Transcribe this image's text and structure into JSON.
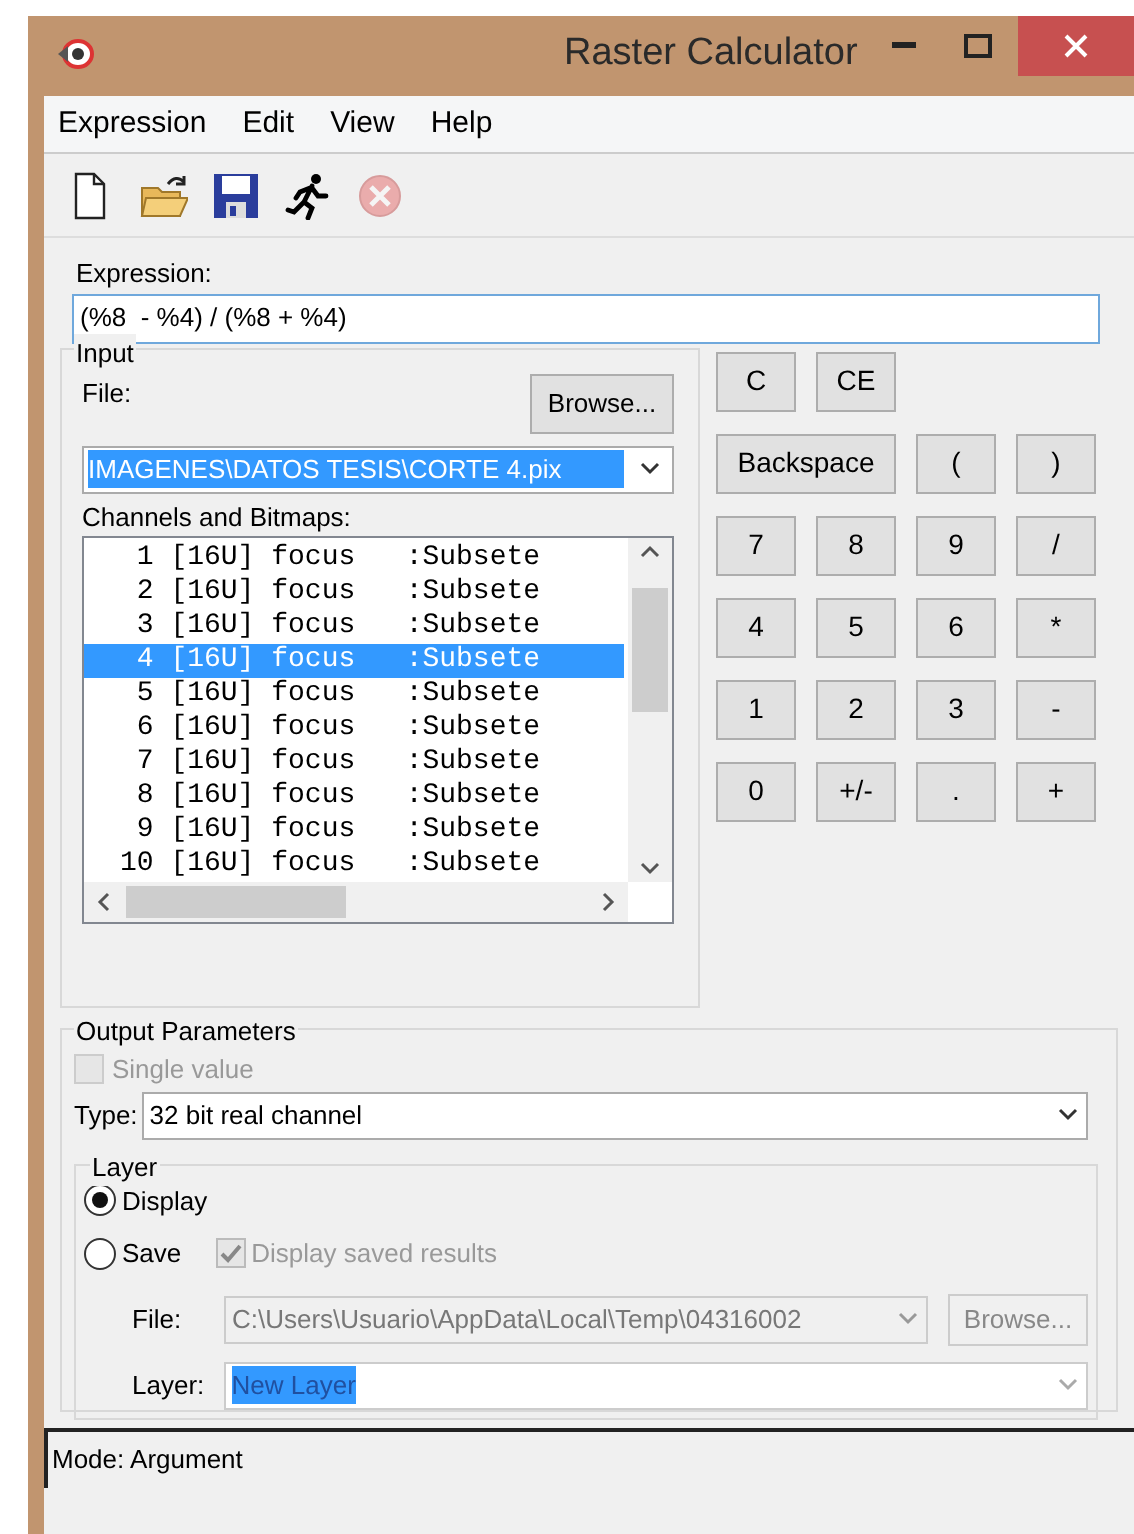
{
  "window": {
    "title": "Raster Calculator"
  },
  "menu": [
    "Expression",
    "Edit",
    "View",
    "Help"
  ],
  "toolbar": [
    {
      "kind": "new",
      "disabled": false
    },
    {
      "kind": "open",
      "disabled": false
    },
    {
      "kind": "save",
      "disabled": false
    },
    {
      "kind": "run",
      "disabled": false
    },
    {
      "kind": "stop",
      "disabled": true
    }
  ],
  "expression": {
    "label": "Expression:",
    "value": "(%8  - %4) / (%8 + %4)"
  },
  "input": {
    "title": "Input",
    "file_label": "File:",
    "browse": "Browse...",
    "file_value": "IMAGENES\\DATOS TESIS\\CORTE 4.pix",
    "file_highlighted": true,
    "channels_label": "Channels and Bitmaps:",
    "channels": [
      {
        "text": " 1 [16U] focus   :Subsete",
        "selected": false
      },
      {
        "text": " 2 [16U] focus   :Subsete",
        "selected": false
      },
      {
        "text": " 3 [16U] focus   :Subsete",
        "selected": false
      },
      {
        "text": " 4 [16U] focus   :Subsete",
        "selected": true
      },
      {
        "text": " 5 [16U] focus   :Subsete",
        "selected": false
      },
      {
        "text": " 6 [16U] focus   :Subsete",
        "selected": false
      },
      {
        "text": " 7 [16U] focus   :Subsete",
        "selected": false
      },
      {
        "text": " 8 [16U] focus   :Subsete",
        "selected": false
      },
      {
        "text": " 9 [16U] focus   :Subsete",
        "selected": false
      },
      {
        "text": "10 [16U] focus   :Subsete",
        "selected": false
      }
    ]
  },
  "keypad": [
    [
      {
        "label": "C",
        "kind": "normal"
      },
      {
        "label": "CE",
        "kind": "normal"
      }
    ],
    [
      {
        "label": "Backspace",
        "kind": "wide"
      },
      {
        "label": "(",
        "kind": "normal"
      },
      {
        "label": ")",
        "kind": "normal"
      }
    ],
    [
      {
        "label": "7",
        "kind": "normal"
      },
      {
        "label": "8",
        "kind": "normal"
      },
      {
        "label": "9",
        "kind": "normal"
      },
      {
        "label": "/",
        "kind": "normal"
      }
    ],
    [
      {
        "label": "4",
        "kind": "normal"
      },
      {
        "label": "5",
        "kind": "normal"
      },
      {
        "label": "6",
        "kind": "normal"
      },
      {
        "label": "*",
        "kind": "normal"
      }
    ],
    [
      {
        "label": "1",
        "kind": "normal"
      },
      {
        "label": "2",
        "kind": "normal"
      },
      {
        "label": "3",
        "kind": "normal"
      },
      {
        "label": "-",
        "kind": "normal"
      }
    ],
    [
      {
        "label": "0",
        "kind": "normal"
      },
      {
        "label": "+/-",
        "kind": "normal"
      },
      {
        "label": ".",
        "kind": "normal"
      },
      {
        "label": "+",
        "kind": "normal"
      }
    ]
  ],
  "output": {
    "title": "Output Parameters",
    "single_value": {
      "label": "Single value",
      "checked": false,
      "disabled": true
    },
    "type_label": "Type:",
    "type_value": "32 bit real channel",
    "layer_group": {
      "title": "Layer",
      "options": [
        {
          "label": "Display",
          "selected": true
        },
        {
          "label": "Save",
          "selected": false
        }
      ],
      "display_saved": {
        "label": "Display saved results",
        "checked": true,
        "disabled": true
      },
      "file_label": "File:",
      "file_value": "C:\\Users\\Usuario\\AppData\\Local\\Temp\\04316002",
      "file_disabled": true,
      "browse": "Browse...",
      "browse_disabled": true,
      "layer_label": "Layer:",
      "layer_value": "New Layer",
      "layer_highlighted": true
    }
  },
  "status_bar": "Mode: Argument"
}
